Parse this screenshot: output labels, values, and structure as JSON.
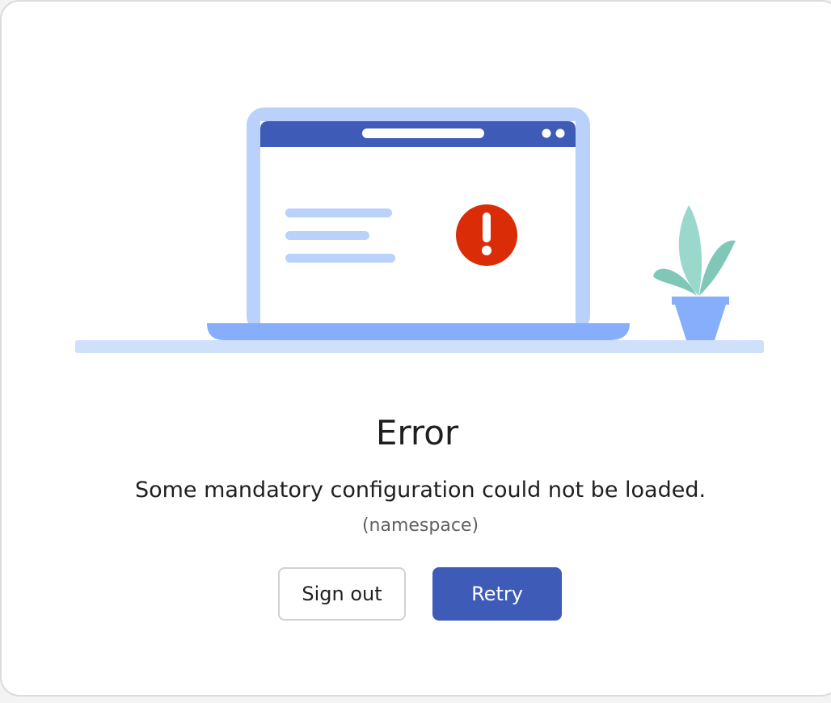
{
  "dialog": {
    "title": "Error",
    "message": "Some mandatory configuration could not be loaded.",
    "detail": "(namespace)"
  },
  "buttons": {
    "sign_out_label": "Sign out",
    "retry_label": "Retry"
  },
  "colors": {
    "primary": "#3f5bb8",
    "error": "#d92c07",
    "laptop_frame": "#b9d1fb",
    "plant_leaf": "#8fd4c4"
  },
  "icons": {
    "illustration": "laptop-error-illustration",
    "alert": "exclamation-icon"
  }
}
